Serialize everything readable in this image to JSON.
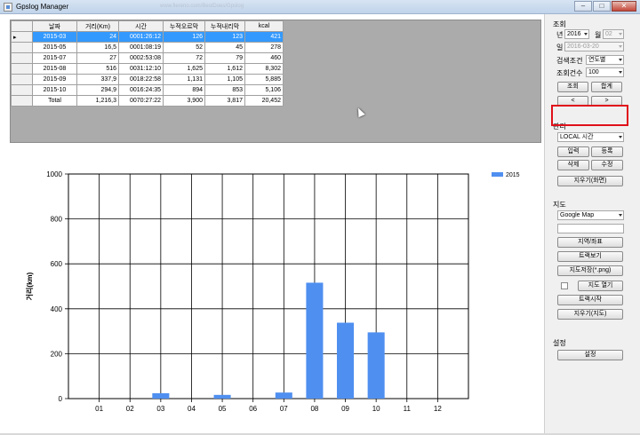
{
  "window": {
    "title": "Gpslog Manager",
    "ghost_url": "www.fiereno.com/BestDoes/Gpslog",
    "buttons": [
      "–",
      "□",
      "✕"
    ]
  },
  "grid": {
    "columns": [
      "날짜",
      "거리(Km)",
      "시간",
      "누적오르막",
      "누적내리막",
      "kcal"
    ],
    "rows": [
      {
        "date": "2015-03",
        "distance": "24",
        "time": "0001:26:12",
        "asc": "126",
        "desc": "123",
        "kcal": "421",
        "selected": true
      },
      {
        "date": "2015-05",
        "distance": "16,5",
        "time": "0001:08:19",
        "asc": "52",
        "desc": "45",
        "kcal": "278"
      },
      {
        "date": "2015-07",
        "distance": "27",
        "time": "0002:53:08",
        "asc": "72",
        "desc": "79",
        "kcal": "460"
      },
      {
        "date": "2015-08",
        "distance": "516",
        "time": "0031:12:10",
        "asc": "1,625",
        "desc": "1,612",
        "kcal": "8,302"
      },
      {
        "date": "2015-09",
        "distance": "337,9",
        "time": "0018:22:58",
        "asc": "1,131",
        "desc": "1,105",
        "kcal": "5,885"
      },
      {
        "date": "2015-10",
        "distance": "294,9",
        "time": "0016:24:35",
        "asc": "894",
        "desc": "853",
        "kcal": "5,106"
      },
      {
        "date": "Total",
        "distance": "1,216,3",
        "time": "0070:27:22",
        "asc": "3,900",
        "desc": "3,817",
        "kcal": "20,452"
      }
    ]
  },
  "chart_data": {
    "type": "bar",
    "categories": [
      "01",
      "02",
      "03",
      "04",
      "05",
      "06",
      "07",
      "08",
      "09",
      "10",
      "11",
      "12"
    ],
    "series": [
      {
        "name": "2015",
        "values": [
          0,
          0,
          24,
          0,
          16.5,
          0,
          27,
          516,
          337.9,
          294.9,
          0,
          0
        ],
        "color": "#4f8ff0"
      }
    ],
    "ylabel": "거리(km)",
    "ylim": [
      0,
      1000
    ],
    "yticks": [
      0,
      200,
      400,
      600,
      800,
      1000
    ],
    "grid": true,
    "legend": "top-right"
  },
  "panel": {
    "query_section": "조회",
    "year_label": "년",
    "year_value": "2016",
    "month_label": "월",
    "month_value": "02",
    "day_label": "일",
    "day_value": "2016-03-20",
    "criteria_label": "검색조건",
    "criteria_value": "연도별",
    "count_label": "조회건수",
    "count_value": "100",
    "query_button": "조회",
    "sum_button": "합계",
    "prev_button": "<",
    "next_button": ">",
    "manage_section": "관리",
    "time_combo": "LOCAL 시간",
    "input_button": "입력",
    "register_button": "등록",
    "delete_button": "삭제",
    "edit_button": "수정",
    "clear_screen_button": "지우기(화면)",
    "map_section": "지도",
    "map_combo": "Google Map",
    "region_button": "지역/좌표",
    "track_view_button": "트랙보기",
    "save_map_button": "지도저장(*.png)",
    "open_map_button": "지도 열기",
    "track_start_button": "트랙시작",
    "clear_map_button": "지우기(지도)",
    "settings_section": "설정",
    "settings_button": "설정"
  },
  "colors": {
    "selection": "#3399ff",
    "bar": "#4f8ff0",
    "highlight": "#e0101a"
  }
}
